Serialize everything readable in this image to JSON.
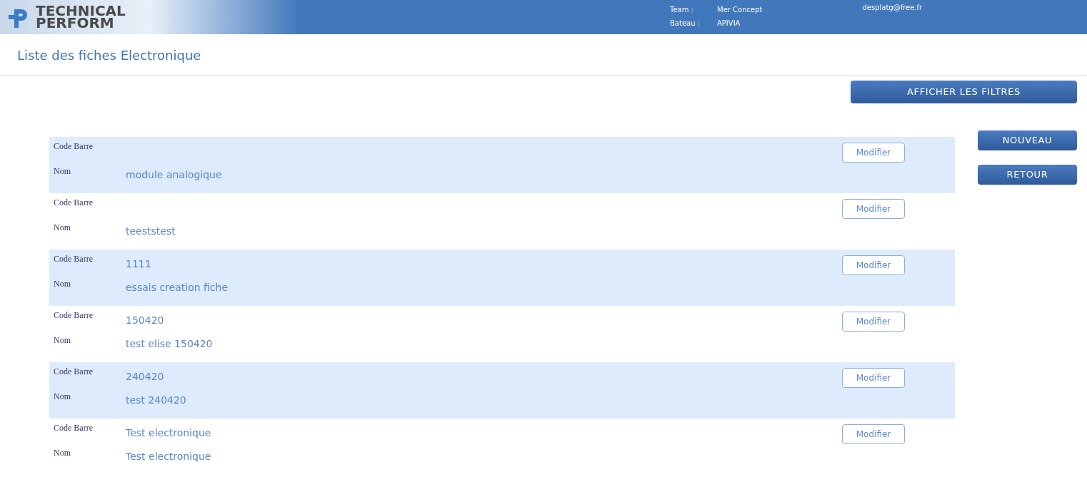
{
  "header": {
    "logo": {
      "line1": "TECHNICAL",
      "line2": "PERFORM"
    },
    "team_label": "Team :",
    "team": "Mer Concept",
    "boat_label": "Bateau :",
    "boat": "APIVIA",
    "user": "desplatg@free.fr"
  },
  "page_title": "Liste des fiches Electronique",
  "filter_button": "AFFICHER LES FILTRES",
  "side_buttons": [
    "NOUVEAU",
    "RETOUR"
  ],
  "rows": [
    {
      "barcode_label": "Code Barre",
      "name_label": "Nom",
      "name": "module analogique",
      "action": "Modifier"
    },
    {
      "barcode_label": "Code Barre",
      "name_label": "Nom",
      "name": "teeststest",
      "action": "Modifier"
    },
    {
      "barcode_label": "Code Barre",
      "barcode": "1111",
      "name_label": "Nom",
      "name": "essais creation fiche",
      "action": "Modifier"
    },
    {
      "barcode_label": "Code Barre",
      "barcode": "150420",
      "name_label": "Nom",
      "name": "test elise 150420",
      "action": "Modifier"
    },
    {
      "barcode_label": "Code Barre",
      "barcode": "240420",
      "name_label": "Nom",
      "name": "test 240420",
      "action": "Modifier"
    },
    {
      "barcode_label": "Code Barre",
      "barcode": "Test electronique",
      "name_label": "Nom",
      "name": "Test electronique",
      "action": "Modifier"
    }
  ]
}
